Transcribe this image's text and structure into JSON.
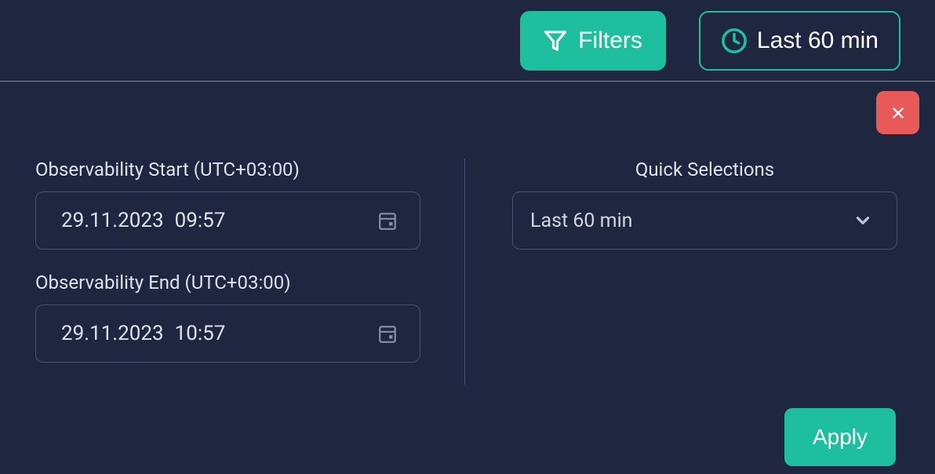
{
  "header": {
    "filters_label": "Filters",
    "timerange_label": "Last 60 min"
  },
  "panel": {
    "start_label": "Observability Start (UTC+03:00)",
    "start_date": "29.11.2023",
    "start_time": "09:57",
    "end_label": "Observability End (UTC+03:00)",
    "end_date": "29.11.2023",
    "end_time": "10:57",
    "quick_label": "Quick Selections",
    "quick_value": "Last 60 min",
    "apply_label": "Apply"
  }
}
